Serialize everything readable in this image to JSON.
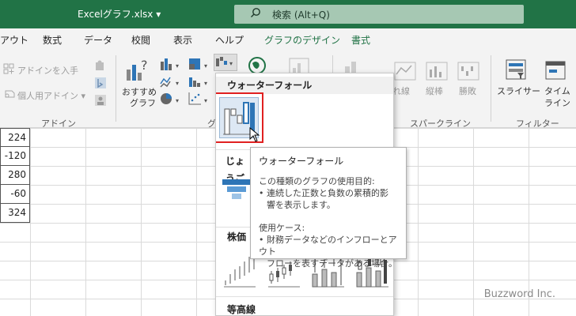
{
  "window": {
    "filename": "Excelグラフ.xlsx",
    "search_placeholder": "検索 (Alt+Q)"
  },
  "tabs": [
    {
      "label": "アウト"
    },
    {
      "label": "数式"
    },
    {
      "label": "データ"
    },
    {
      "label": "校閲"
    },
    {
      "label": "表示"
    },
    {
      "label": "ヘルプ"
    },
    {
      "label": "グラフのデザイン"
    },
    {
      "label": "書式"
    }
  ],
  "ribbon": {
    "addin_get": "アドインを入手",
    "addin_personal": "個人用アドイン",
    "addin_group": "アドイン",
    "recommended_line1": "おすすめ",
    "recommended_line2": "グラフ",
    "chart_group_partial": "グ",
    "spark_line": "折れ線",
    "spark_column": "縦棒",
    "spark_winloss": "勝敗",
    "spark_group": "スパークライン",
    "slicer": "スライサー",
    "timeline_line1": "タイム",
    "timeline_line2": "ライン",
    "filter_group": "フィルター"
  },
  "cells": [
    "224",
    "-120",
    "280",
    "-60",
    "324"
  ],
  "dropdown": {
    "waterfall_header": "ウォーターフォール",
    "funnel_header": "じょうご",
    "stock_header": "株価",
    "surface_header": "等高線"
  },
  "tooltip": {
    "title": "ウォーターフォール",
    "purpose_label": "この種類のグラフの使用目的:",
    "purpose_line1": "• 連続した正数と負数の累積的影",
    "purpose_line2": "響を表示します。",
    "cases_label": "使用ケース:",
    "cases_line1": "• 財務データなどのインフローとアウト",
    "cases_line2": "フローを表すデータがある場合。"
  },
  "watermark": "Buzzword Inc.",
  "colors": {
    "excel_green": "#217346",
    "accent_blue": "#2e75b6",
    "highlight_red": "#e02020"
  }
}
